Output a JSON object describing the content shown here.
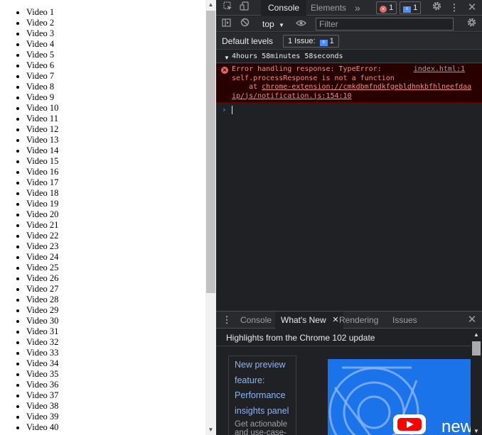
{
  "page": {
    "videos": [
      "Video 1",
      "Video 2",
      "Video 3",
      "Video 4",
      "Video 5",
      "Video 6",
      "Video 7",
      "Video 8",
      "Video 9",
      "Video 10",
      "Video 11",
      "Video 12",
      "Video 13",
      "Video 14",
      "Video 15",
      "Video 16",
      "Video 17",
      "Video 18",
      "Video 19",
      "Video 20",
      "Video 21",
      "Video 22",
      "Video 23",
      "Video 24",
      "Video 25",
      "Video 26",
      "Video 27",
      "Video 28",
      "Video 29",
      "Video 30",
      "Video 31",
      "Video 32",
      "Video 33",
      "Video 34",
      "Video 35",
      "Video 36",
      "Video 37",
      "Video 38",
      "Video 39",
      "Video 40"
    ]
  },
  "devtools": {
    "tabs": {
      "console": "Console",
      "elements": "Elements",
      "more": "»"
    },
    "error_count": "1",
    "message_count": "1",
    "context": "top",
    "filter_placeholder": "Filter",
    "default_levels": "Default levels",
    "issues_label": "1 Issue:",
    "issues_count": "1",
    "log_line": "4hours 58minutes 58seconds",
    "error": {
      "line1": "Error handling response: TypeError:",
      "line2": "self.processResponse is not a function",
      "at": "    at ",
      "link": "chrome-extension://cmkdbmfndkfgebldhnkbfhlneefdaaip/js/notification.js:154:10",
      "source": "index.html:1"
    },
    "prompt_symbol": "›"
  },
  "drawer": {
    "tabs": [
      "Console",
      "What's New",
      "Rendering",
      "Issues"
    ],
    "active_tab": "What's New",
    "subtitle": "Highlights from the Chrome 102 update",
    "feature_title": "New preview feature: Performance insights panel",
    "feature_desc": "Get actionable and use-case-",
    "promo_text": "new"
  },
  "icons": {
    "inspect": "inspect-element-icon",
    "device": "device-toggle-icon",
    "settings": "gear-icon",
    "menu": "kebab-menu-icon",
    "close": "close-icon",
    "sidebar": "sidebar-toggle-icon",
    "clear": "clear-console-icon",
    "eye": "live-expression-icon",
    "play": "youtube-play-icon"
  },
  "colors": {
    "devtools_bg": "#202124",
    "toolbar_bg": "#292a2d",
    "error_bg": "#290000",
    "error_text": "#f28b82",
    "accent_blue": "#8ab4f8",
    "promo_blue": "#1a73e8"
  }
}
